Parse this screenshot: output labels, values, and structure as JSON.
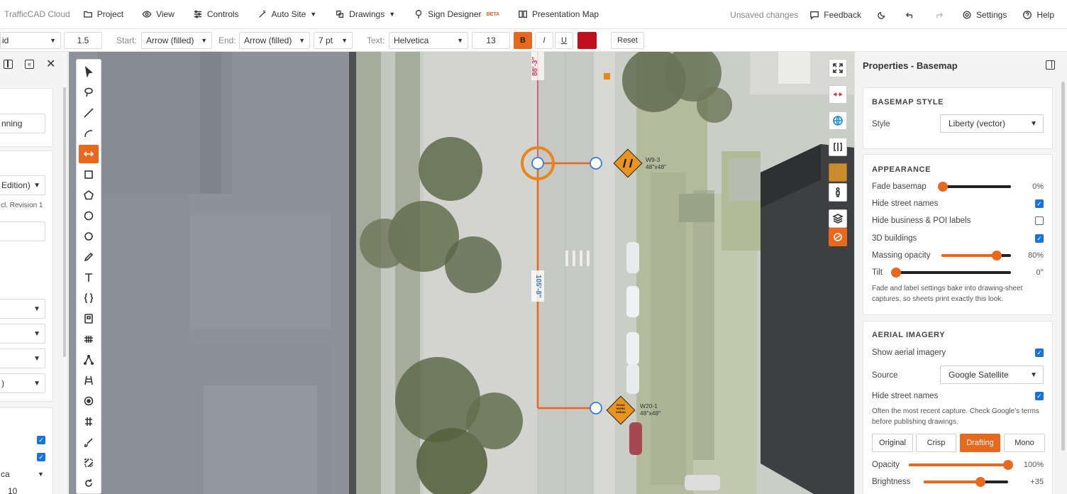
{
  "topbar": {
    "app_name": "TrafficCAD Cloud",
    "menu": [
      {
        "label": "Project",
        "icon": "folder-icon"
      },
      {
        "label": "View",
        "icon": "eye-icon"
      },
      {
        "label": "Controls",
        "icon": "sliders-icon"
      },
      {
        "label": "Auto Site",
        "icon": "magic-wand-icon"
      },
      {
        "label": "Drawings",
        "icon": "drawings-icon"
      },
      {
        "label": "Sign Designer",
        "icon": "sign-icon",
        "badge": "BETA"
      },
      {
        "label": "Presentation Map",
        "icon": "book-icon"
      }
    ],
    "status": "Unsaved changes",
    "feedback": "Feedback",
    "settings": "Settings",
    "help": "Help"
  },
  "formatbar": {
    "line_style": "id",
    "width_value": "1.5",
    "start_label": "Start:",
    "start_value": "Arrow (filled)",
    "end_label": "End:",
    "end_value": "Arrow (filled)",
    "size_value": "7 pt",
    "text_label": "Text:",
    "font_value": "Helvetica",
    "font_size": "13",
    "bold": "B",
    "italic": "I",
    "underline": "U",
    "color": "#c0101e",
    "reset": "Reset"
  },
  "leftpanel": {
    "field1": "nning",
    "select1": "Edition)",
    "note": "cl. Revision 1",
    "select_tail": ")",
    "text_row": "ca",
    "num_row": "10"
  },
  "map": {
    "dimension_top": "88'-3\"",
    "dimension_mid": "105'-8\"",
    "sign1_code": "W9-3",
    "sign1_size": "48\"x48\"",
    "sign2_code": "W20-1",
    "sign2_size": "48\"x48\"",
    "sign2_text": "ROAD WORK AHEAD"
  },
  "properties": {
    "title": "Properties - Basemap",
    "basemap_style": {
      "heading": "BASEMAP STYLE",
      "style_label": "Style",
      "style_value": "Liberty (vector)"
    },
    "appearance": {
      "heading": "APPEARANCE",
      "fade_label": "Fade basemap",
      "fade_value": "0%",
      "fade_level": 0,
      "hide_street_label": "Hide street names",
      "hide_street_checked": true,
      "hide_business_label": "Hide business & POI labels",
      "hide_business_checked": false,
      "buildings_label": "3D buildings",
      "buildings_checked": true,
      "massing_label": "Massing opacity",
      "massing_value": "80%",
      "massing_level": 0.8,
      "tilt_label": "Tilt",
      "tilt_value": "0°",
      "tilt_level": 0,
      "note": "Fade and label settings bake into drawing-sheet captures, so sheets print exactly this look."
    },
    "aerial": {
      "heading": "AERIAL IMAGERY",
      "show_label": "Show aerial imagery",
      "show_checked": true,
      "source_label": "Source",
      "source_value": "Google Satellite",
      "hide_street_label": "Hide street names",
      "hide_street_checked": true,
      "note": "Often the most recent capture. Check Google's terms before publishing drawings.",
      "modes": [
        "Original",
        "Crisp",
        "Drafting",
        "Mono"
      ],
      "active_mode": "Drafting",
      "opacity_label": "Opacity",
      "opacity_value": "100%",
      "opacity_level": 1.0,
      "brightness_label": "Brightness",
      "brightness_value": "+35",
      "brightness_level": 0.675
    }
  },
  "colors": {
    "accent": "#e8681e",
    "checkbox": "#1a73d8",
    "dimension_top": "#d03a5a",
    "dimension_mid": "#3a7bd5"
  }
}
